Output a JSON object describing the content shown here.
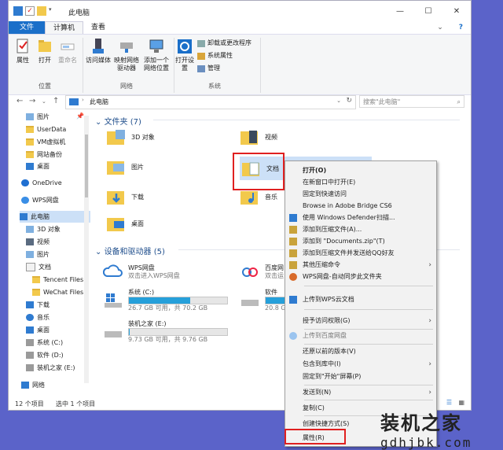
{
  "window": {
    "title": "此电脑",
    "controls": [
      "—",
      "☐",
      "✕"
    ]
  },
  "ribbon": {
    "tabs": [
      "文件",
      "计算机",
      "查看"
    ],
    "buttons": {
      "properties": "属性",
      "open": "打开",
      "rename": "重命名",
      "access_media": "访问媒体",
      "map_drive": "映射网络驱动器",
      "add_location": "添加一个网络位置",
      "open_settings": "打开设置",
      "uninstall": "卸载或更改程序",
      "sys_props": "系统属性",
      "manage": "管理"
    },
    "groups": [
      "位置",
      "网络",
      "系统"
    ]
  },
  "address": {
    "path": "此电脑",
    "search_placeholder": "搜索\"此电脑\""
  },
  "nav": [
    {
      "label": "图片",
      "icon": "picture-folder-icon"
    },
    {
      "label": "UserData",
      "icon": "folder-icon"
    },
    {
      "label": "VM虚拟机",
      "icon": "folder-icon"
    },
    {
      "label": "网站备份",
      "icon": "folder-icon"
    },
    {
      "label": "桌面",
      "icon": "desktop-icon"
    },
    {
      "label": "OneDrive",
      "icon": "cloud-icon"
    },
    {
      "label": "WPS网盘",
      "icon": "wps-cloud-icon"
    },
    {
      "label": "此电脑",
      "icon": "computer-icon"
    },
    {
      "label": "3D 对象",
      "icon": "3d-icon"
    },
    {
      "label": "视频",
      "icon": "video-icon"
    },
    {
      "label": "图片",
      "icon": "picture-folder-icon"
    },
    {
      "label": "文档",
      "icon": "document-icon"
    },
    {
      "label": "Tencent Files",
      "icon": "folder-icon"
    },
    {
      "label": "WeChat Files",
      "icon": "folder-icon"
    },
    {
      "label": "下载",
      "icon": "download-icon"
    },
    {
      "label": "音乐",
      "icon": "music-icon"
    },
    {
      "label": "桌面",
      "icon": "desktop-icon"
    },
    {
      "label": "系统 (C:)",
      "icon": "drive-icon"
    },
    {
      "label": "软件 (D:)",
      "icon": "drive-icon"
    },
    {
      "label": "装机之家 (E:)",
      "icon": "drive-icon"
    },
    {
      "label": "网络",
      "icon": "network-icon"
    }
  ],
  "content": {
    "folders_header": "文件夹 (7)",
    "folders": [
      "3D 对象",
      "视频",
      "图片",
      "文档",
      "下载",
      "音乐",
      "桌面"
    ],
    "devices_header": "设备和驱动器 (5)",
    "wps": {
      "name": "WPS网盘",
      "sub": "双击进入WPS网盘"
    },
    "baidu": {
      "name": "百度网",
      "sub": "双击运"
    },
    "drives": [
      {
        "name": "系统 (C:)",
        "info": "26.7 GB 可用，共 70.2 GB",
        "used": 0.62
      },
      {
        "name": "软件",
        "info": "20.8 G",
        "used": 0.55
      },
      {
        "name": "装机之家 (E:)",
        "info": "9.73 GB 可用，共 9.76 GB",
        "used": 0.01
      }
    ]
  },
  "status": {
    "count": "12 个项目",
    "selected": "选中 1 个项目"
  },
  "context_menu": {
    "open": "打开(O)",
    "new_window": "在新窗口中打开(E)",
    "pin_quick": "固定到快速访问",
    "adobe_bridge": "Browse in Adobe Bridge CS6",
    "defender": "使用 Windows Defender扫描...",
    "add_archive": "添加到压缩文件(A)...",
    "add_zip": "添加到 \"Documents.zip\"(T)",
    "add_qq": "添加到压缩文件并发送给QQ好友",
    "other_compress": "其他压缩命令",
    "wps_sync": "WPS网盘-自动同步此文件夹",
    "upload_wps": "上传到WPS云文档",
    "grant_access": "授予访问权限(G)",
    "upload_baidu": "上传到百度网盘",
    "restore_prev": "还原以前的版本(V)",
    "include_lib": "包含到库中(I)",
    "pin_start": "固定到\"开始\"屏幕(P)",
    "send_to": "发送到(N)",
    "copy": "复制(C)",
    "create_shortcut": "创建快捷方式(S)",
    "properties": "属性(R)"
  },
  "watermark": {
    "title": "装机之家",
    "url": "gdhjbk.com"
  },
  "colors": {
    "accent": "#1a6fc9",
    "highlight": "#e02020",
    "drive_bar": "#26a0da",
    "folder": "#f2c94c"
  }
}
